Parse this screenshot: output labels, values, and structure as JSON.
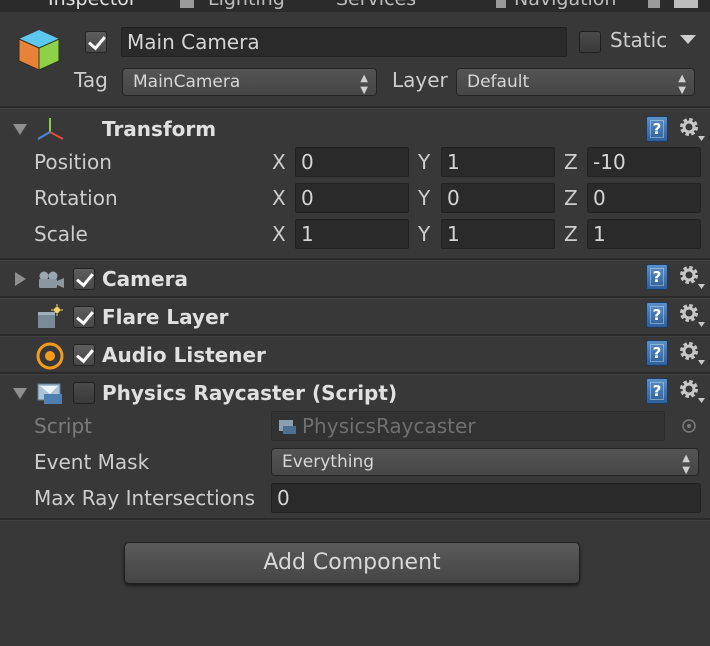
{
  "tabs": [
    {
      "label": "Inspector"
    },
    {
      "label": "Lighting"
    },
    {
      "label": "Services"
    },
    {
      "label": "Navigation"
    }
  ],
  "header": {
    "active": true,
    "object_name": "Main Camera",
    "static_label": "Static",
    "static_checked": false,
    "tag_label": "Tag",
    "tag_value": "MainCamera",
    "layer_label": "Layer",
    "layer_value": "Default"
  },
  "transform": {
    "title": "Transform",
    "rows": [
      {
        "label": "Position",
        "x": "0",
        "y": "1",
        "z": "-10"
      },
      {
        "label": "Rotation",
        "x": "0",
        "y": "0",
        "z": "0"
      },
      {
        "label": "Scale",
        "x": "1",
        "y": "1",
        "z": "1"
      }
    ],
    "axis": {
      "x": "X",
      "y": "Y",
      "z": "Z"
    }
  },
  "components": [
    {
      "title": "Camera",
      "enabled": true,
      "icon": "camera-icon"
    },
    {
      "title": "Flare Layer",
      "enabled": true,
      "icon": "flare-layer-icon"
    },
    {
      "title": "Audio Listener",
      "enabled": true,
      "icon": "audio-listener-icon"
    }
  ],
  "physics_raycaster": {
    "title": "Physics Raycaster (Script)",
    "enabled": false,
    "script_label": "Script",
    "script_value": "PhysicsRaycaster",
    "event_mask_label": "Event Mask",
    "event_mask_value": "Everything",
    "max_ray_label": "Max Ray Intersections",
    "max_ray_value": "0"
  },
  "add_component_label": "Add Component",
  "help_glyph": "?"
}
